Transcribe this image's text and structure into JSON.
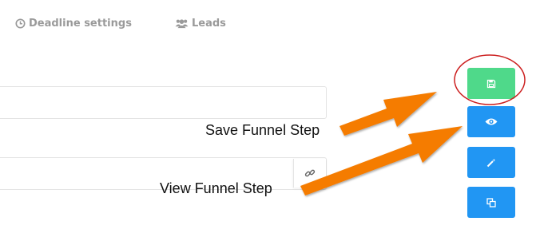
{
  "tabs": [
    {
      "label": "Deadline settings",
      "icon": "clock-icon"
    },
    {
      "label": "Leads",
      "icon": "users-icon"
    }
  ],
  "actions": {
    "save": {
      "icon": "floppy-disk-icon",
      "color": "#4fd98a"
    },
    "view": {
      "icon": "eye-icon",
      "color": "#2196f3"
    },
    "magic": {
      "icon": "magic-wand-icon",
      "color": "#2196f3"
    },
    "copy": {
      "icon": "clone-icon",
      "color": "#2196f3"
    }
  },
  "url_field": {
    "icon": "link-icon"
  },
  "annotations": {
    "save_label": "Save Funnel Step",
    "view_label": "View Funnel Step",
    "arrow_color": "#f57c00",
    "highlight_color": "#cc1f1f"
  }
}
